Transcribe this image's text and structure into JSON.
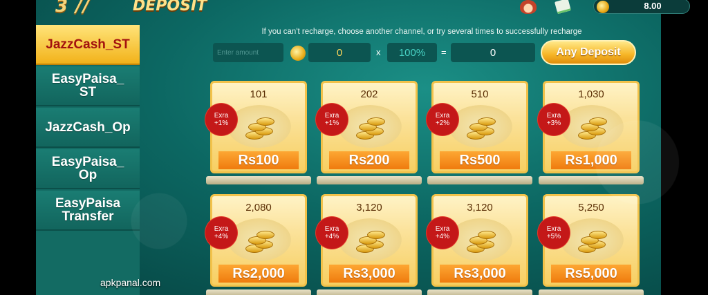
{
  "header": {
    "title": "DEPOSIT",
    "balance": "8.00"
  },
  "sidebar": {
    "items": [
      {
        "label": "JazzCash_ST",
        "active": true
      },
      {
        "label": "EasyPaisa_\nST",
        "active": false
      },
      {
        "label": "JazzCash_Op",
        "active": false
      },
      {
        "label": "EasyPaisa_\nOp",
        "active": false
      },
      {
        "label": "EasyPaisa\nTransfer",
        "active": false
      }
    ]
  },
  "hint": "If you can't recharge, choose another channel, or try several times to successfully recharge",
  "calculator": {
    "placeholder": "Enter amount",
    "coins": "0",
    "multiply": "x",
    "rate": "100%",
    "equals": "=",
    "total": "0",
    "button": "Any Deposit"
  },
  "cards": [
    {
      "coins": "101",
      "badge_top": "Exra",
      "badge_bottom": "+1%",
      "price": "Rs100"
    },
    {
      "coins": "202",
      "badge_top": "Exra",
      "badge_bottom": "+1%",
      "price": "Rs200"
    },
    {
      "coins": "510",
      "badge_top": "Exra",
      "badge_bottom": "+2%",
      "price": "Rs500"
    },
    {
      "coins": "1,030",
      "badge_top": "Exra",
      "badge_bottom": "+3%",
      "price": "Rs1,000"
    },
    {
      "coins": "2,080",
      "badge_top": "Exra",
      "badge_bottom": "+4%",
      "price": "Rs2,000"
    },
    {
      "coins": "3,120",
      "badge_top": "Exra",
      "badge_bottom": "+4%",
      "price": "Rs3,000"
    },
    {
      "coins": "3,120",
      "badge_top": "Exra",
      "badge_bottom": "+4%",
      "price": "Rs3,000"
    },
    {
      "coins": "5,250",
      "badge_top": "Exra",
      "badge_bottom": "+5%",
      "price": "Rs5,000"
    }
  ],
  "watermark": "apkpanal.com",
  "colors": {
    "background": "#0c6762",
    "active_tab": "#f2b21a",
    "active_tab_text": "#a3120f",
    "price_bar": "#ef7b0e",
    "badge": "#c41818"
  }
}
